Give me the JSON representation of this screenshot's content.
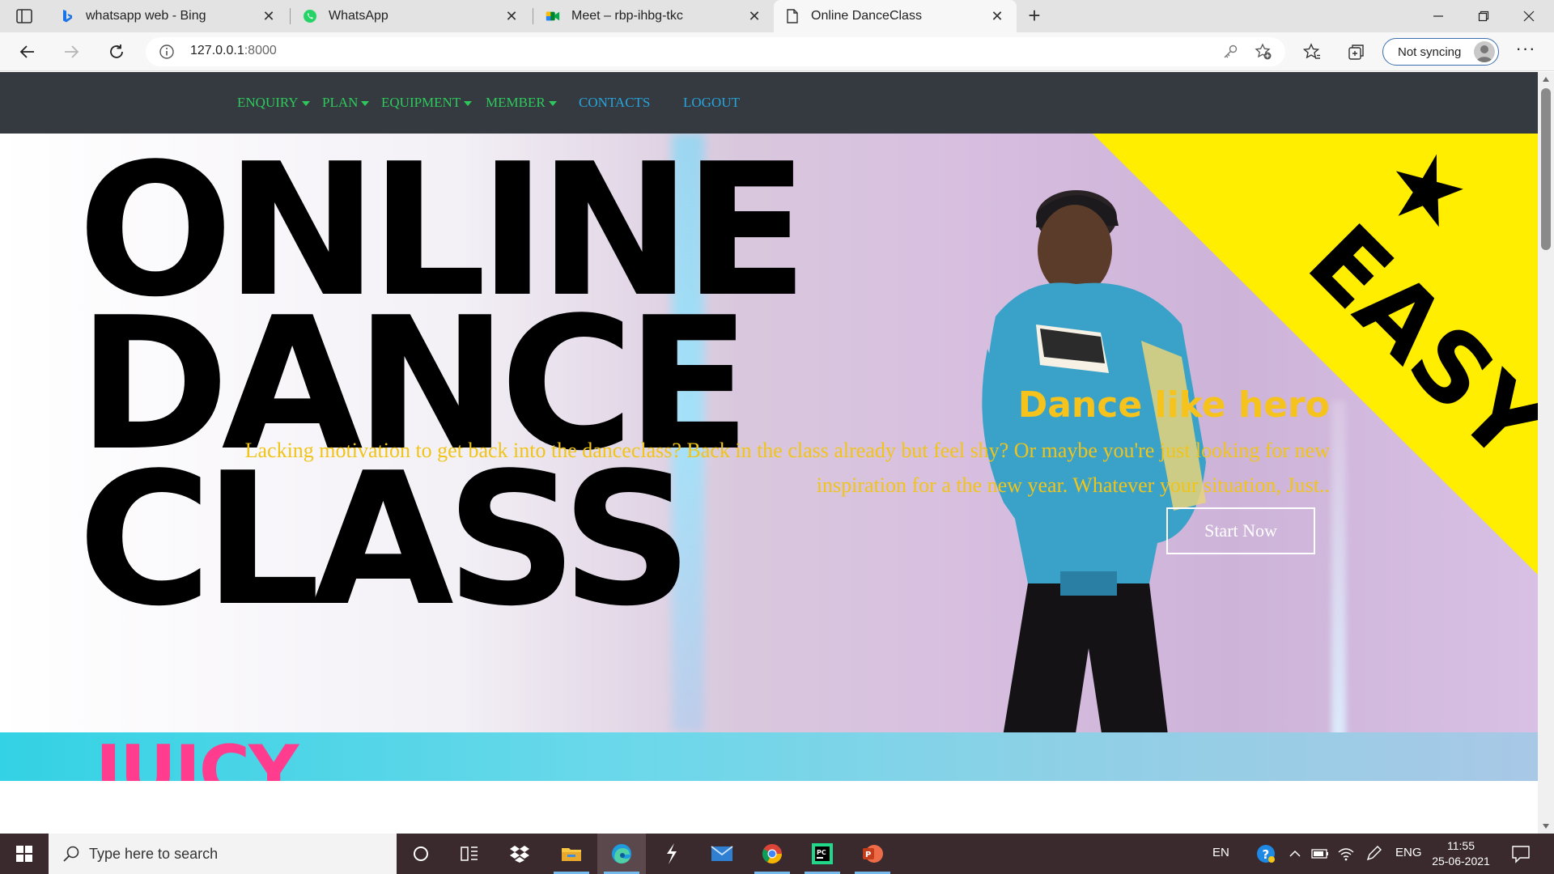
{
  "browser": {
    "tabs": [
      {
        "title": "whatsapp web - Bing",
        "icon": "bing-icon"
      },
      {
        "title": "WhatsApp",
        "icon": "whatsapp-icon"
      },
      {
        "title": "Meet – rbp-ihbg-tkc",
        "icon": "google-meet-icon"
      },
      {
        "title": "Online DanceClass",
        "icon": "page-icon",
        "active": true
      }
    ],
    "address": {
      "host": "127.0.0.1",
      "port": ":8000"
    },
    "sync_label": "Not syncing"
  },
  "site": {
    "nav": [
      {
        "label": "ENQUIRY",
        "dropdown": true
      },
      {
        "label": "PLAN",
        "dropdown": true
      },
      {
        "label": "EQUIPMENT",
        "dropdown": true
      },
      {
        "label": "MEMBER",
        "dropdown": true
      },
      {
        "label": "CONTACTS",
        "dropdown": false
      },
      {
        "label": "LOGOUT",
        "dropdown": false
      }
    ],
    "hero": {
      "title_lines": [
        "ONLINE",
        "DANCE",
        "CLASS"
      ],
      "badge": "EASY",
      "banner_fragment": "JUICY",
      "heading": "Dance like hero",
      "text": "Lacking motivation to get back into the danceclass? Back in the class already but feel shy? Or maybe you're just looking for new inspiration for a the new year. Whatever your situation, Just..",
      "button": "Start Now"
    },
    "colors": {
      "nav_bg": "#343a40",
      "nav_green": "#2ec95c",
      "nav_blue": "#27a4dc",
      "accent_yellow": "#f6c21c",
      "badge_yellow": "#ffee00"
    }
  },
  "taskbar": {
    "search_placeholder": "Type here to search",
    "lang_short": "EN",
    "lang": "ENG",
    "time": "11:55",
    "date": "25-06-2021"
  }
}
